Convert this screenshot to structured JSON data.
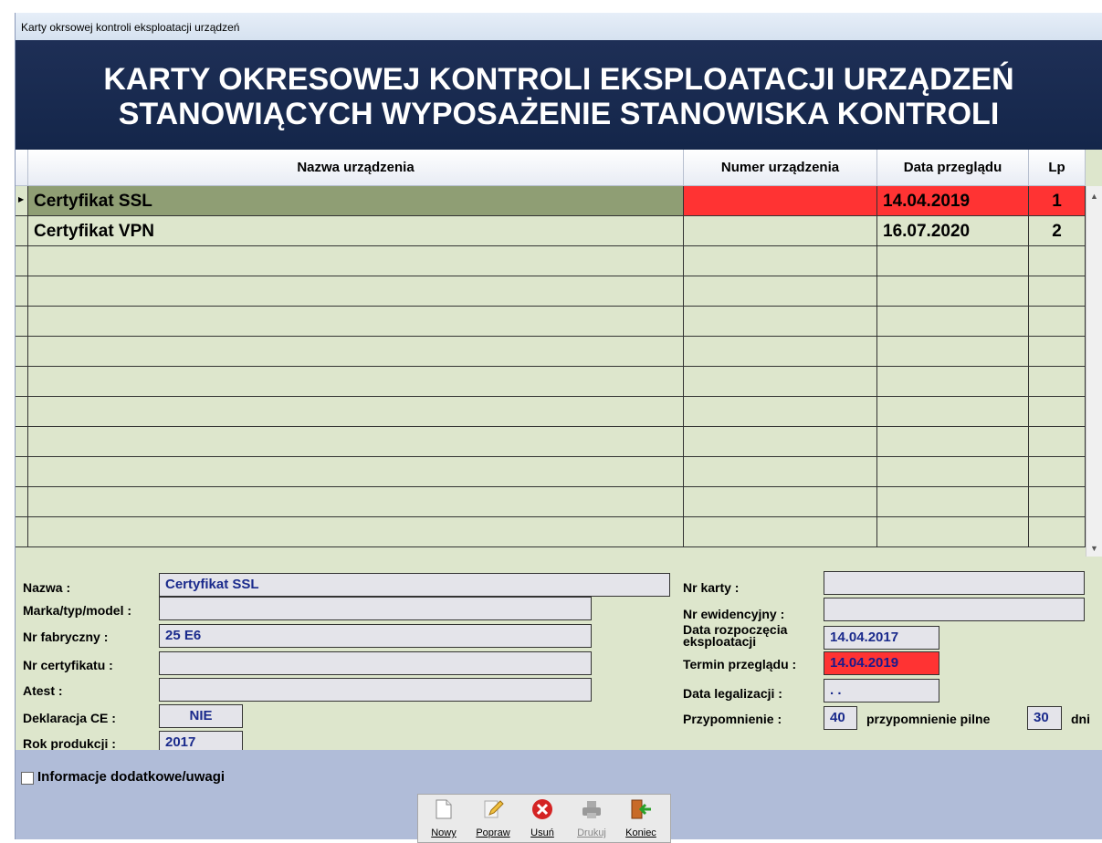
{
  "window": {
    "title": "Karty okrsowej kontroli eksploatacji urządzeń"
  },
  "banner": {
    "line1": "KARTY OKRESOWEJ KONTROLI EKSPLOATACJI URZĄDZEŃ",
    "line2": "STANOWIĄCYCH WYPOSAŻENIE STANOWISKA KONTROLI"
  },
  "table": {
    "columns": [
      "Nazwa urządzenia",
      "Numer urządzenia",
      "Data przeglądu",
      "Lp"
    ],
    "rows": [
      {
        "name": "Certyfikat SSL",
        "number": "",
        "date": "14.04.2019",
        "lp": "1"
      },
      {
        "name": "Certyfikat VPN",
        "number": "",
        "date": "16.07.2020",
        "lp": "2"
      }
    ]
  },
  "details": {
    "nazwa_label": "Nazwa :",
    "nazwa": "Certyfikat SSL",
    "marka_label": "Marka/typ/model :",
    "marka": "",
    "nr_fab_label": "Nr fabryczny :",
    "nr_fab": "25 E6",
    "nr_cert_label": "Nr certyfikatu :",
    "nr_cert": "",
    "atest_label": "Atest :",
    "atest": "",
    "deklaracja_label": "Deklaracja CE :",
    "deklaracja": "NIE",
    "rok_label": "Rok produkcji :",
    "rok": "2017",
    "nr_karty_label": "Nr karty :",
    "nr_karty": "",
    "nr_ewid_label": "Nr ewidencyjny :",
    "nr_ewid": "",
    "data_rozp_label1": "Data rozpoczęcia",
    "data_rozp_label2": "eksploatacji",
    "data_rozp": "14.04.2017",
    "termin_label": "Termin przeglądu :",
    "termin": "14.04.2019",
    "data_leg_label": "Data legalizacji :",
    "data_leg": ". .",
    "przyp_label": "Przypomnienie :",
    "przyp": "40",
    "przyp_pilne_label": "przypomnienie pilne",
    "przyp_pilne": "30",
    "dni_label": "dni"
  },
  "extra": {
    "checkbox_label": "Informacje dodatkowe/uwagi"
  },
  "toolbar": {
    "nowy": "Nowy",
    "popraw": "Popraw",
    "usun": "Usuń",
    "drukuj": "Drukuj",
    "koniec": "Koniec"
  },
  "colors": {
    "banner": "#1e2f56",
    "grid": "#dde6cc",
    "selected_row": "#8f9e74",
    "alert": "#ff3333",
    "value_text": "#1a2a8c"
  }
}
